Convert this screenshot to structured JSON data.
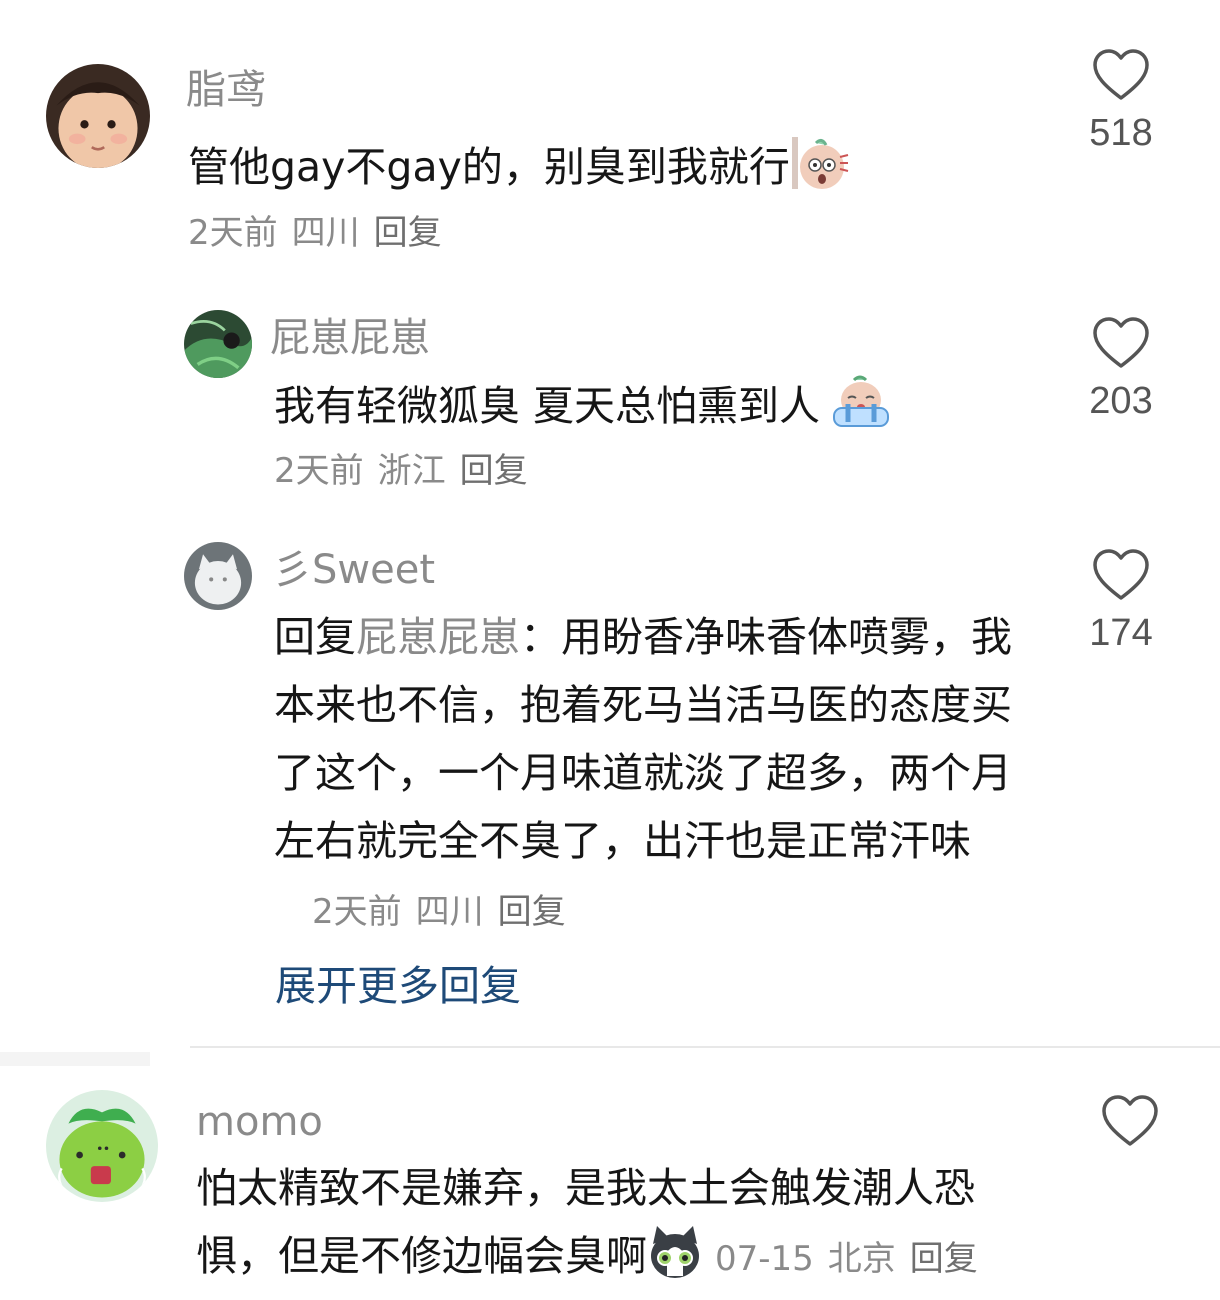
{
  "comments": [
    {
      "username": "脂鸢",
      "text": "管他gay不gay的，别臭到我就行",
      "time": "2天前",
      "location": "四川",
      "reply_label": "回复",
      "likes": "518",
      "avatar_icon": "baby-face-avatar",
      "emoji_icon": "shocked-bean-emoji"
    },
    {
      "username": "屁崽屁崽",
      "text": "我有轻微狐臭 夏天总怕熏到人",
      "time": "2天前",
      "location": "浙江",
      "reply_label": "回复",
      "likes": "203",
      "avatar_icon": "green-leaf-avatar",
      "emoji_icon": "crying-bean-emoji"
    },
    {
      "username": "彡Sweet",
      "reply_prefix": "回复",
      "mention": "屁崽屁崽",
      "colon": "：",
      "text": "用盼香净味香体喷雾，我本来也不信，抱着死马当活马医的态度买了这个，一个月味道就淡了超多，两个月左右就完全不臭了，出汗也是正常汗味",
      "time": "2天前",
      "location": "四川",
      "reply_label": "回复",
      "likes": "174",
      "avatar_icon": "white-cat-avatar"
    },
    {
      "username": "momo",
      "text": "怕太精致不是嫌弃，是我太土会触发潮人恐惧，但是不修边幅会臭啊",
      "time": "07-15",
      "location": "北京",
      "reply_label": "回复",
      "likes": "",
      "avatar_icon": "green-blob-avatar",
      "emoji_icon": "grey-cat-emoji"
    }
  ],
  "expand_more_label": "展开更多回复",
  "colors": {
    "text": "#161616",
    "secondary": "#8a8a8a",
    "link": "#1e4a78",
    "divider": "#e8e8e8"
  }
}
